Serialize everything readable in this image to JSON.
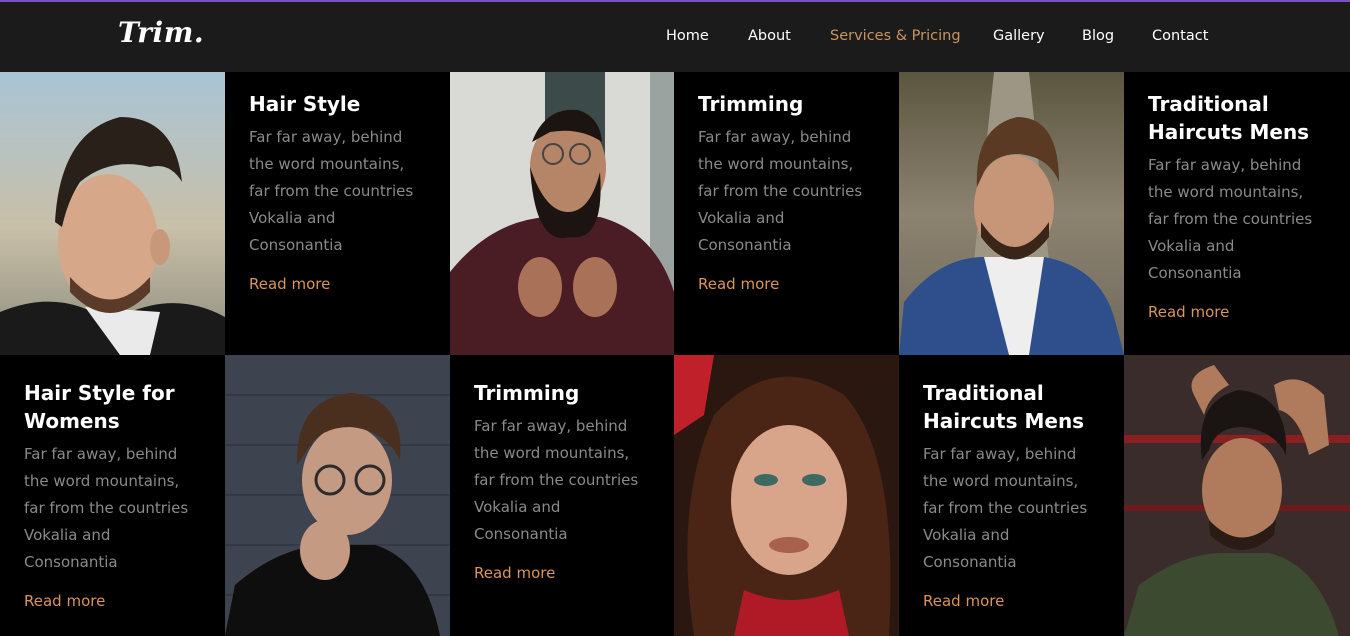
{
  "brand": {
    "logo": "Trim."
  },
  "nav": {
    "items": [
      "Home",
      "About",
      "Services & Pricing",
      "Gallery",
      "Blog",
      "Contact"
    ],
    "active_index": 2
  },
  "services": [
    {
      "title": "Hair Style",
      "description": "Far far away, behind the word mountains, far from the countries Vokalia and Consonantia",
      "link": "Read more"
    },
    {
      "title": "Trimming",
      "description": "Far far away, behind the word mountains, far from the countries Vokalia and Consonantia",
      "link": "Read more"
    },
    {
      "title": "Traditional Haircuts Mens",
      "description": "Far far away, behind the word mountains, far from the countries Vokalia and Consonantia",
      "link": "Read more"
    },
    {
      "title": "Hair Style for Womens",
      "description": "Far far away, behind the word mountains, far from the countries Vokalia and Consonantia",
      "link": "Read more"
    },
    {
      "title": "Trimming",
      "description": "Far far away, behind the word mountains, far from the countries Vokalia and Consonantia",
      "link": "Read more"
    },
    {
      "title": "Traditional Haircuts Mens",
      "description": "Far far away, behind the word mountains, far from the countries Vokalia and Consonantia",
      "link": "Read more"
    }
  ],
  "colors": {
    "accent": "#d9955a",
    "nav_active": "#c9945e",
    "top_border": "#7b4fc7",
    "navbar_bg": "#1b1b1b"
  }
}
